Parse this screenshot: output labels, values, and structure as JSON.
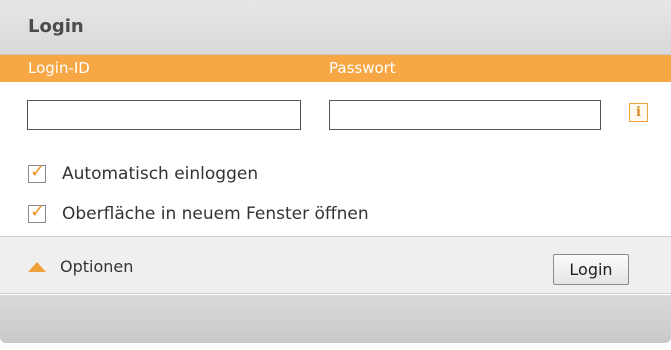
{
  "header": {
    "title": "Login"
  },
  "labels": {
    "login_id": "Login-ID",
    "password": "Passwort"
  },
  "fields": {
    "login_id": {
      "value": "",
      "placeholder": ""
    },
    "password": {
      "value": "",
      "placeholder": ""
    }
  },
  "info_icon": {
    "name": "info-icon",
    "glyph": "i"
  },
  "checkboxes": [
    {
      "label": "Automatisch einloggen",
      "checked": true
    },
    {
      "label": "Oberfläche in neuem Fenster öffnen",
      "checked": true
    }
  ],
  "options": {
    "label": "Optionen",
    "icon": "triangle-up-icon"
  },
  "login_button": {
    "label": "Login"
  },
  "colors": {
    "accent": "#f7a744",
    "header_bg": "#e0e0e0",
    "text": "#333333"
  }
}
